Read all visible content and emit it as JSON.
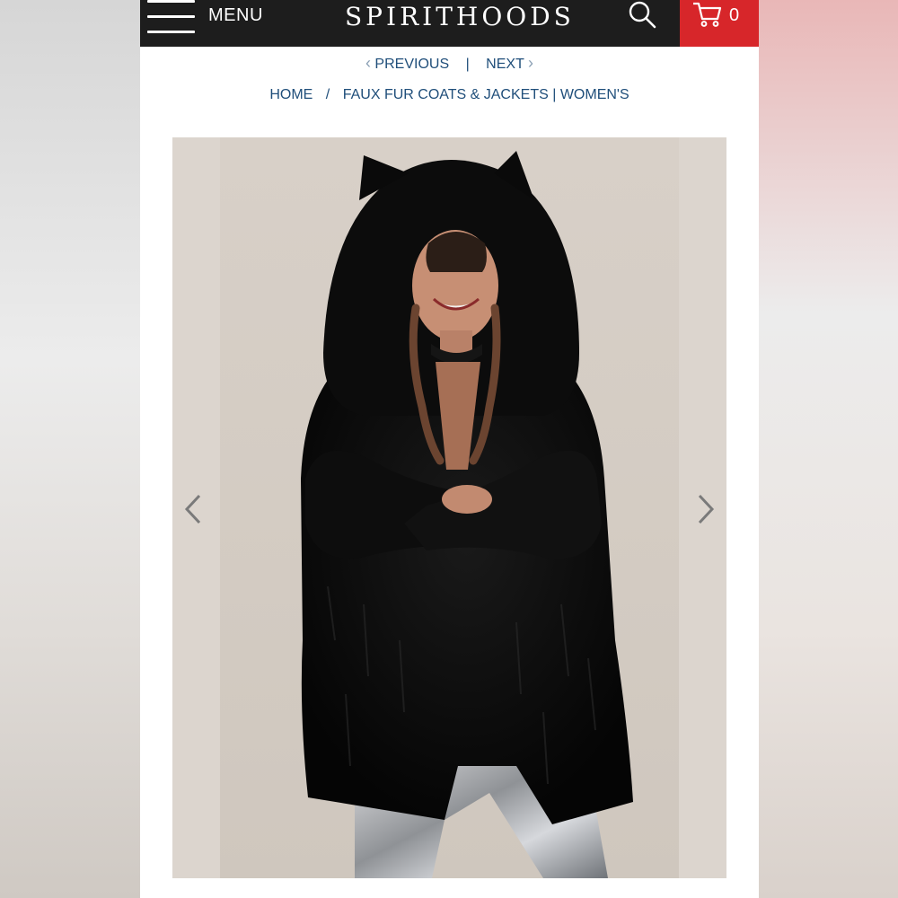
{
  "header": {
    "menu_label": "MENU",
    "logo_text": "SPIRITHOODS",
    "cart_count": "0",
    "icons": [
      "hamburger-icon",
      "search-icon",
      "cart-icon"
    ],
    "colors": {
      "bar": "#1d1d1d",
      "cart_bg": "#d7262a",
      "link": "#1f4e7a"
    }
  },
  "pager": {
    "previous_label": "PREVIOUS",
    "separator": "|",
    "next_label": "NEXT"
  },
  "breadcrumb": {
    "home": "HOME",
    "separator": "/",
    "category": "FAUX FUR COATS & JACKETS | WOMEN'S"
  },
  "gallery": {
    "image_alt": "Model wearing black faux fur hooded coat with ears",
    "icons": [
      "chevron-left-icon",
      "chevron-right-icon"
    ]
  }
}
